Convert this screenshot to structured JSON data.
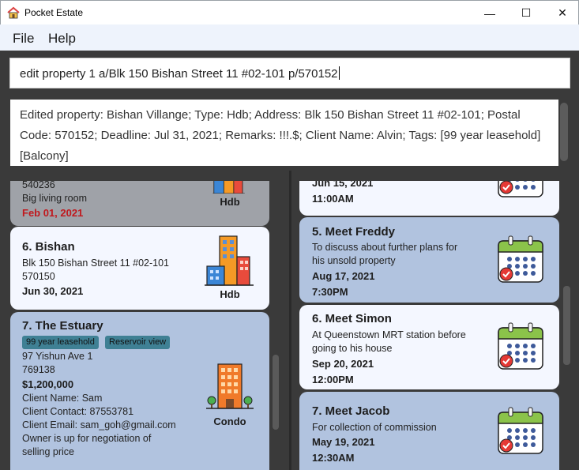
{
  "window": {
    "title": "Pocket Estate",
    "minimize": "—",
    "maximize": "☐",
    "close": "✕"
  },
  "menu": {
    "file": "File",
    "help": "Help"
  },
  "command_box": {
    "value": "edit property 1 a/Blk 150 Bishan Street 11 #02-101 p/570152"
  },
  "result_display": {
    "text": "Edited property: Bishan Villange; Type: Hdb; Address: Blk 150 Bishan Street 11 #02-101; Postal Code: 570152; Deadline: Jul 31, 2021; Remarks: !!!.$; Client Name: Alvin; Tags: [99 year leasehold][Balcony]"
  },
  "properties": [
    {
      "partial_top": true,
      "postal": "540236",
      "remark": "Big living room",
      "deadline": "Feb 01, 2021",
      "type": "Hdb",
      "icon": "hdb-building-icon"
    },
    {
      "index_name": "6.  Bishan",
      "address": "Blk 150 Bishan Street 11 #02-101",
      "postal": "570150",
      "deadline": "Jun 30, 2021",
      "type": "Hdb",
      "icon": "hdb-building-icon"
    },
    {
      "index_name": "7.  The Estuary",
      "tags": [
        "99 year leasehold",
        "Reservoir view"
      ],
      "address": "97 Yishun Ave 1",
      "postal": "769138",
      "price": "$1,200,000",
      "client_name": "Client Name: Sam",
      "client_contact": "Client Contact: 87553781",
      "client_email": "Client Email: sam_goh@gmail.com",
      "remark_line1": "Owner is up for negotiation of",
      "remark_line2": "selling price",
      "type": "Condo",
      "icon": "condo-building-icon"
    }
  ],
  "appointments": [
    {
      "partial_top": true,
      "date": "Jun 15, 2021",
      "time": "11:00AM",
      "icon": "calendar-icon"
    },
    {
      "index_name": "5.  Meet Freddy",
      "remark_line1": "To discuss about further plans for",
      "remark_line2": "his unsold property",
      "date": "Aug 17, 2021",
      "time": "7:30PM",
      "icon": "calendar-icon"
    },
    {
      "index_name": "6.  Meet Simon",
      "remark_line1": "At Queenstown MRT station before",
      "remark_line2": "going to his house",
      "date": "Sep 20, 2021",
      "time": "12:00PM",
      "icon": "calendar-icon"
    },
    {
      "index_name": "7.  Meet Jacob",
      "remark_line1": "For collection of commission",
      "date": "May 19, 2021",
      "time": "12:30AM",
      "icon": "calendar-icon"
    }
  ],
  "colors": {
    "card_light": "#f4f7ff",
    "card_blue": "#b1c3df",
    "background_dark": "#3a3a3a",
    "tag": "#3f8094",
    "overdue": "#c0191e"
  }
}
